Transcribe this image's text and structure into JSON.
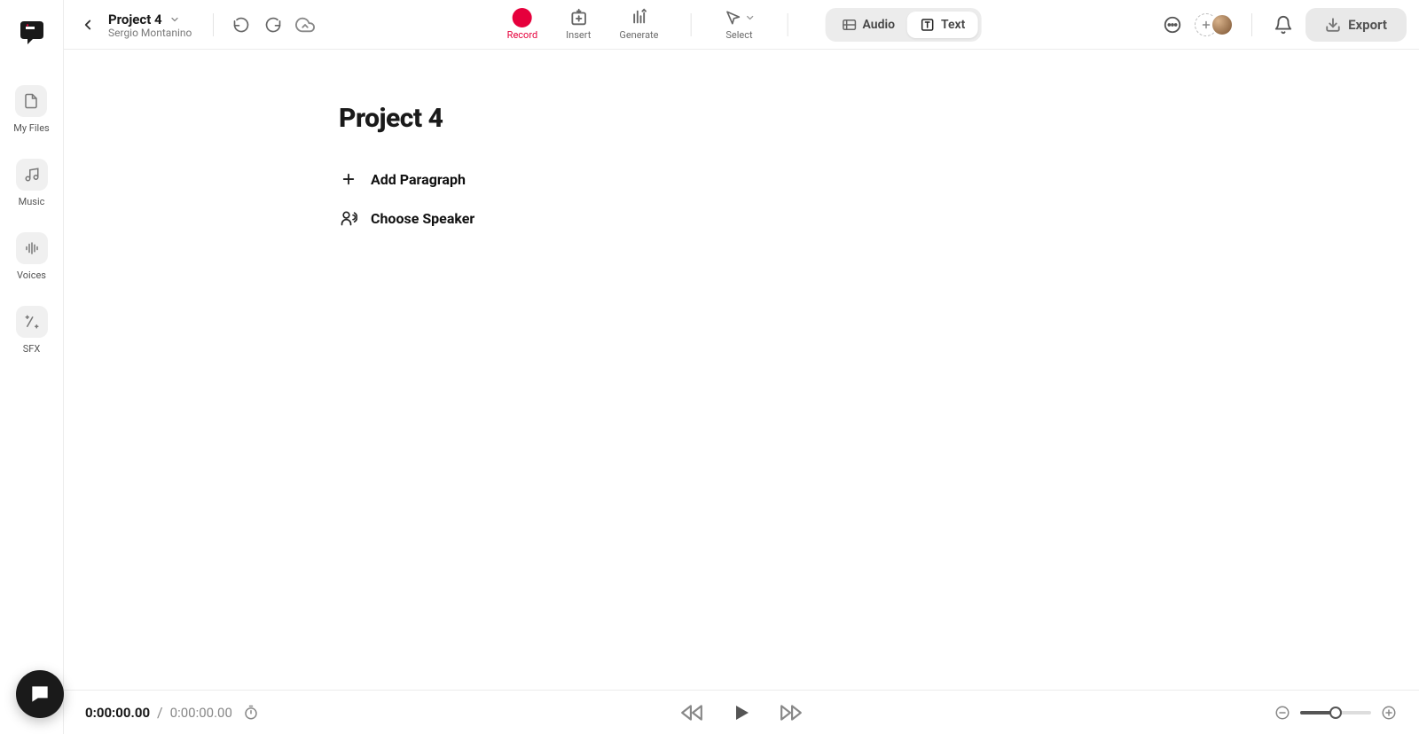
{
  "project": {
    "title": "Project 4",
    "owner": "Sergio Montanino"
  },
  "sidebar": {
    "items": [
      {
        "label": "My Files"
      },
      {
        "label": "Music"
      },
      {
        "label": "Voices"
      },
      {
        "label": "SFX"
      }
    ]
  },
  "tools": {
    "record": "Record",
    "insert": "Insert",
    "generate": "Generate",
    "select": "Select"
  },
  "mode": {
    "audio": "Audio",
    "text": "Text",
    "active": "text"
  },
  "export_label": "Export",
  "document": {
    "title": "Project 4",
    "actions": {
      "add_paragraph": "Add Paragraph",
      "choose_speaker": "Choose Speaker"
    }
  },
  "player": {
    "current": "0:00:00.00",
    "total": "0:00:00.00",
    "zoom_percent": 50
  }
}
